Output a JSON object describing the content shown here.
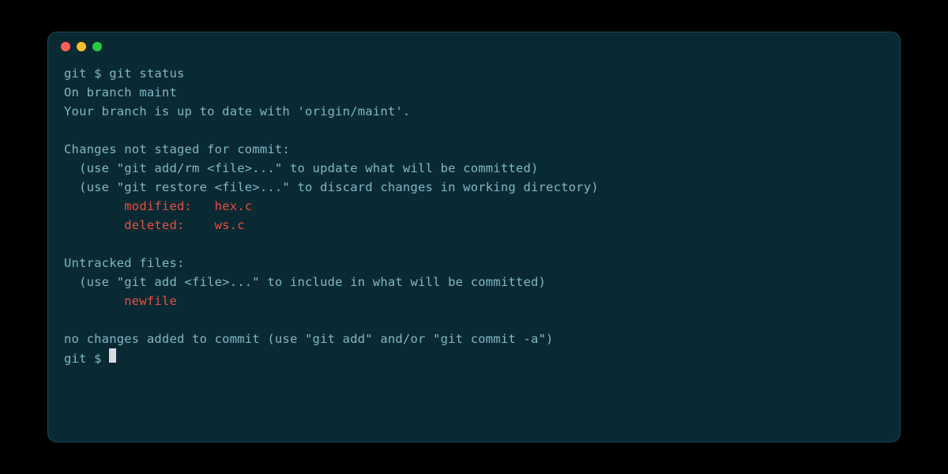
{
  "colors": {
    "background": "#0a2a33",
    "text_default": "#7fb8c4",
    "text_red": "#e84e40",
    "traffic_red": "#ff5f56",
    "traffic_yellow": "#ffbd2e",
    "traffic_green": "#27c93f"
  },
  "prompt1": {
    "prefix": "git $ ",
    "command": "git status"
  },
  "output": {
    "branch_line": "On branch maint",
    "uptodate_line": "Your branch is up to date with 'origin/maint'.",
    "changes_header": "Changes not staged for commit:",
    "hint_add": "  (use \"git add/rm <file>...\" to update what will be committed)",
    "hint_restore": "  (use \"git restore <file>...\" to discard changes in working directory)",
    "modified_entry": "        modified:   hex.c",
    "deleted_entry": "        deleted:    ws.c",
    "untracked_header": "Untracked files:",
    "hint_untracked": "  (use \"git add <file>...\" to include in what will be committed)",
    "untracked_entry": "        newfile",
    "summary": "no changes added to commit (use \"git add\" and/or \"git commit -a\")"
  },
  "prompt2": {
    "prefix": "git $ "
  }
}
